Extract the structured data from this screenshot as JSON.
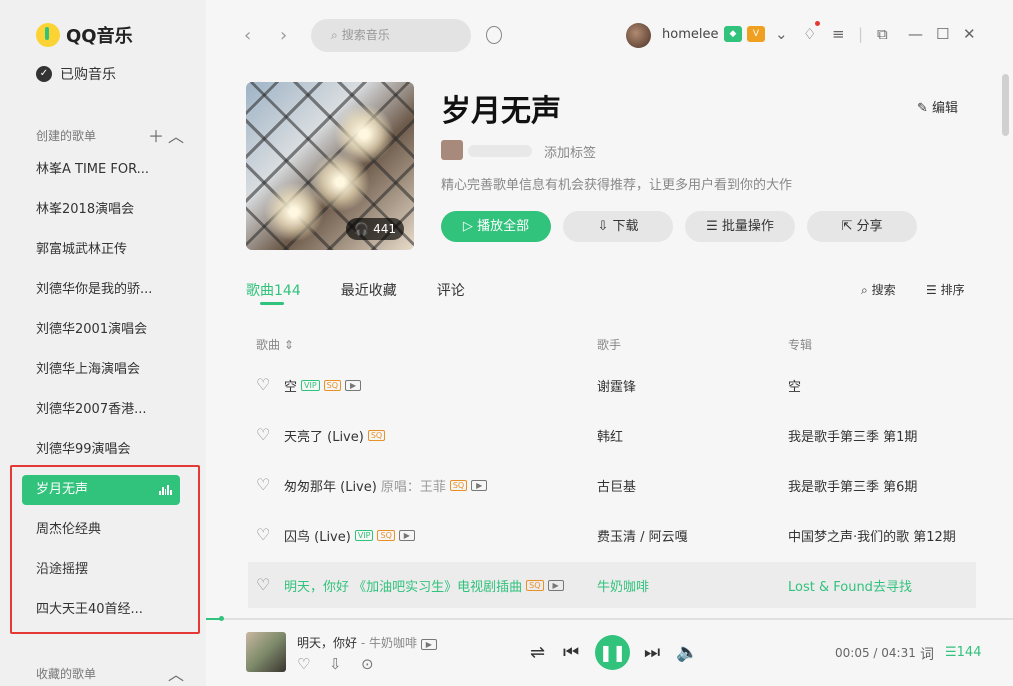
{
  "app": {
    "name": "QQ音乐"
  },
  "sidebar": {
    "purchased": "已购音乐",
    "created_header": "创建的歌单",
    "playlists": [
      {
        "label": "林峯A TIME FOR..."
      },
      {
        "label": "林峯2018演唱会"
      },
      {
        "label": "郭富城武林正传"
      },
      {
        "label": "刘德华你是我的骄..."
      },
      {
        "label": "刘德华2001演唱会"
      },
      {
        "label": "刘德华上海演唱会"
      },
      {
        "label": "刘德华2007香港..."
      },
      {
        "label": "刘德华99演唱会"
      },
      {
        "label": "岁月无声",
        "active": true
      },
      {
        "label": "周杰伦经典"
      },
      {
        "label": "沿途摇摆"
      },
      {
        "label": "四大天王40首经..."
      }
    ],
    "collected_header": "收藏的歌单"
  },
  "topbar": {
    "search_placeholder": "搜索音乐",
    "username": "homelee"
  },
  "playlist": {
    "title": "岁月无声",
    "edit_label": "编辑",
    "add_tag": "添加标签",
    "description": "精心完善歌单信息有机会获得推荐，让更多用户看到你的大作",
    "play_count": "441",
    "buttons": {
      "play_all": "播放全部",
      "download": "下载",
      "batch": "批量操作",
      "share": "分享"
    }
  },
  "tabs": [
    {
      "label": "歌曲144",
      "active": true
    },
    {
      "label": "最近收藏"
    },
    {
      "label": "评论"
    }
  ],
  "tools": {
    "search": "搜索",
    "sort": "排序"
  },
  "columns": {
    "song": "歌曲",
    "artist": "歌手",
    "album": "专辑"
  },
  "songs": [
    {
      "title": "空",
      "sub": "",
      "tags": [
        "VIP",
        "SQ",
        "MV"
      ],
      "artist": "谢霆锋",
      "album": "空"
    },
    {
      "title": "天亮了 (Live)",
      "sub": "",
      "tags": [
        "SQ"
      ],
      "artist": "韩红",
      "album": "我是歌手第三季 第1期"
    },
    {
      "title": "匆匆那年 (Live)",
      "sub": "原唱：王菲",
      "tags": [
        "SQ",
        "MV"
      ],
      "artist": "古巨基",
      "album": "我是歌手第三季 第6期"
    },
    {
      "title": "囚鸟 (Live)",
      "sub": "",
      "tags": [
        "VIP",
        "SQ",
        "MV"
      ],
      "artist": "费玉清 / 阿云嘎",
      "album": "中国梦之声·我们的歌 第12期"
    },
    {
      "title": "明天，你好 《加油吧实习生》电视剧插曲",
      "sub": "",
      "tags": [
        "SQ",
        "MV"
      ],
      "artist": "牛奶咖啡",
      "album": "Lost & Found去寻找",
      "playing": true
    }
  ],
  "player": {
    "title": "明天，你好",
    "artist_suffix": " - 牛奶咖啡",
    "current_time": "00:05",
    "total_time": "04:31",
    "time_display": "00:05 / 04:31",
    "lyric_label": "词",
    "queue_count": "144",
    "progress_fraction": 0.018
  },
  "colors": {
    "accent": "#31c27c",
    "highlight_box": "#e53935"
  }
}
